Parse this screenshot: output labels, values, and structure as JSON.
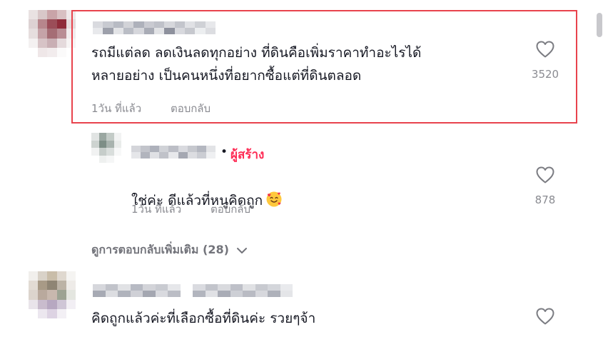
{
  "comments": [
    {
      "text": "รถมีแต่ลด ลดเงินลดทุกอย่าง ที่ดินคือเพิ่มราคาทำอะไรได้\nหลายอย่าง เป็นคนหนึ่งที่อยากซื้อแต่ที่ดินตลอด",
      "time": "1วัน ที่แล้ว",
      "reply_label": "ตอบกลับ",
      "likes": "3520"
    },
    {
      "creator_label": "ผู้สร้าง",
      "text": "ใช่ค่ะ ดีแล้วที่หนูคิดถูก",
      "emoji": "smiling-face-with-hearts",
      "time": "1วัน ที่แล้ว",
      "reply_label": "ตอบกลับ",
      "likes": "878"
    },
    {
      "text": "คิดถูกแล้วค่ะที่เลือกซื้อที่ดินค่ะ รวยๆจ้า"
    }
  ],
  "view_more_replies": "ดูการตอบกลับเพิ่มเติม (28)",
  "icons": [
    "heart-icon",
    "chevron-down-icon",
    "emoji-icon"
  ],
  "colors": {
    "highlight_border": "#e8434d",
    "creator_badge": "#fe2c55",
    "secondary_text": "#8a8b91"
  }
}
